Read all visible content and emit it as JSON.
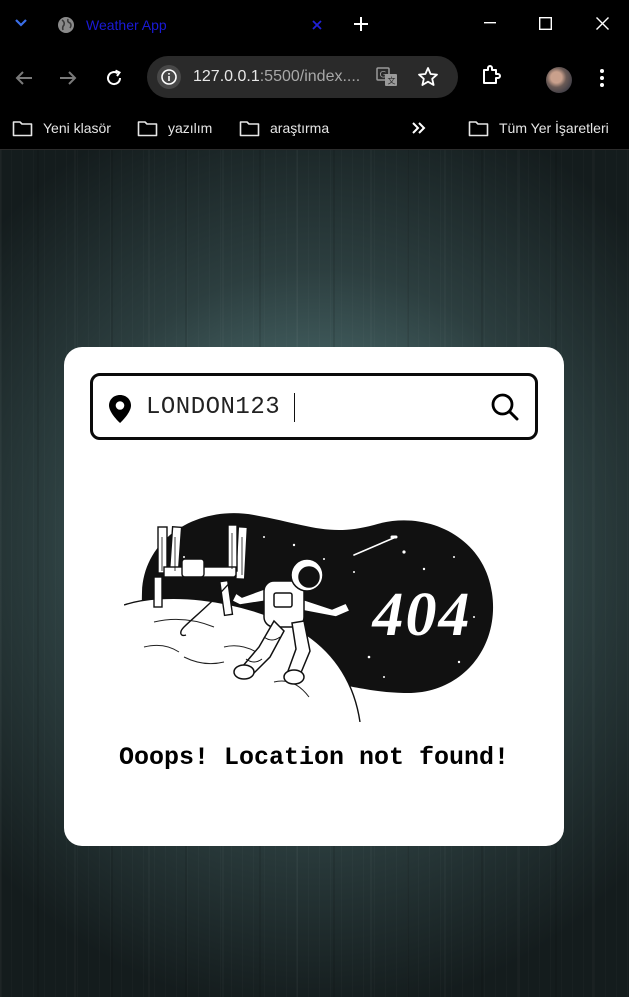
{
  "browser": {
    "tab": {
      "title": "Weather App",
      "icon": "globe-icon"
    },
    "address": {
      "host": "127.0.0.1",
      "rest": ":5500/index...."
    },
    "bookmarks": [
      {
        "label": "Yeni klasör"
      },
      {
        "label": "yazılım"
      },
      {
        "label": "araştırma"
      },
      {
        "label": "Tüm Yer İşaretleri"
      }
    ],
    "colors": {
      "tab_title": "#1a1ad6",
      "chrome_bg": "#000000"
    }
  },
  "app": {
    "search": {
      "value": "LONDON123",
      "icon": "location-pin-icon",
      "button_icon": "search-icon"
    },
    "illustration": {
      "text": "404",
      "icon": "astronaut-404-illustration"
    },
    "message": "Ooops! Location not found!"
  }
}
